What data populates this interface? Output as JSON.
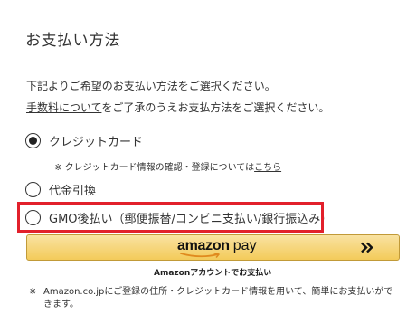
{
  "page": {
    "title": "お支払い方法"
  },
  "intro": {
    "line1": "下記よりご希望のお支払い方法をご選択ください。",
    "fee_link": "手数料について",
    "line2_suffix": "をご了承のうえお支払方法をご選択ください。"
  },
  "payment_methods": [
    {
      "label": "クレジットカード",
      "selected": true
    },
    {
      "label": "代金引換",
      "selected": false
    },
    {
      "label": "GMO後払い（郵便振替/コンビニ支払い/銀行振込み）",
      "selected": false
    }
  ],
  "card_note": {
    "mark": "※",
    "text": "クレジットカード情報の確認・登録については",
    "link": "こちら"
  },
  "amazon_pay": {
    "logo_amazon": "amazon",
    "logo_pay": "pay",
    "arrow": "»",
    "caption": "Amazonアカウントでお支払い",
    "colors": {
      "button_top": "#f9e2a1",
      "button_bottom": "#f3cb5a",
      "border": "#c19a38"
    }
  },
  "footer_note": {
    "mark": "※",
    "text": "Amazon.co.jpにご登録の住所・クレジットカード情報を用いて、簡単にお支払いができます。"
  },
  "colors": {
    "highlight": "#e2202b",
    "text": "#333333"
  },
  "icons": [
    "radio-selected-icon",
    "radio-unselected-icon",
    "amazon-smile-icon",
    "double-chevron-right-icon"
  ]
}
